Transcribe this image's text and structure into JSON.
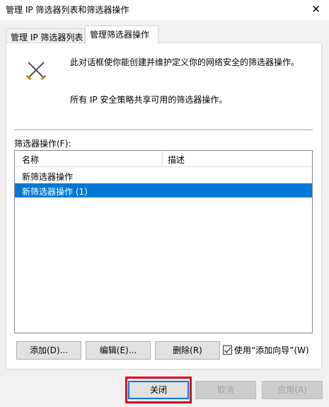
{
  "window": {
    "title": "管理 IP 筛选器列表和筛选器操作",
    "close_glyph": "✕"
  },
  "tabs": [
    {
      "label": "管理 IP 筛选器列表"
    },
    {
      "label": "管理筛选器操作"
    }
  ],
  "info": {
    "line1": "此对话框使你能创建并维护定义你的网络安全的筛选器操作。",
    "line2": "所有 IP 安全策略共享可用的筛选器操作。",
    "icon": "crossed-swords-icon"
  },
  "list": {
    "label": "筛选器操作(F):",
    "columns": [
      "名称",
      "描述"
    ],
    "rows": [
      {
        "name": "新筛选器操作",
        "desc": ""
      },
      {
        "name": "新筛选器操作 (1)",
        "desc": ""
      }
    ],
    "selected_color": "#0078d7"
  },
  "buttons": {
    "add": "添加(D)...",
    "edit": "编辑(E)...",
    "remove": "删除(R)",
    "wizard": "使用“添加向导”(W)"
  },
  "dialog_buttons": {
    "close": "关闭",
    "cancel": "取消",
    "apply": "应用(A)"
  }
}
